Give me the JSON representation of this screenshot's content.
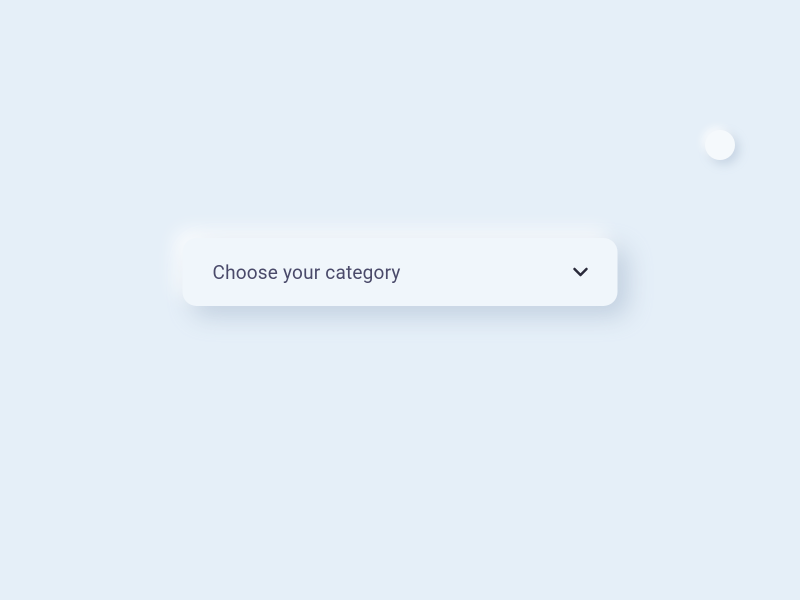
{
  "dropdown": {
    "placeholder": "Choose your category"
  }
}
